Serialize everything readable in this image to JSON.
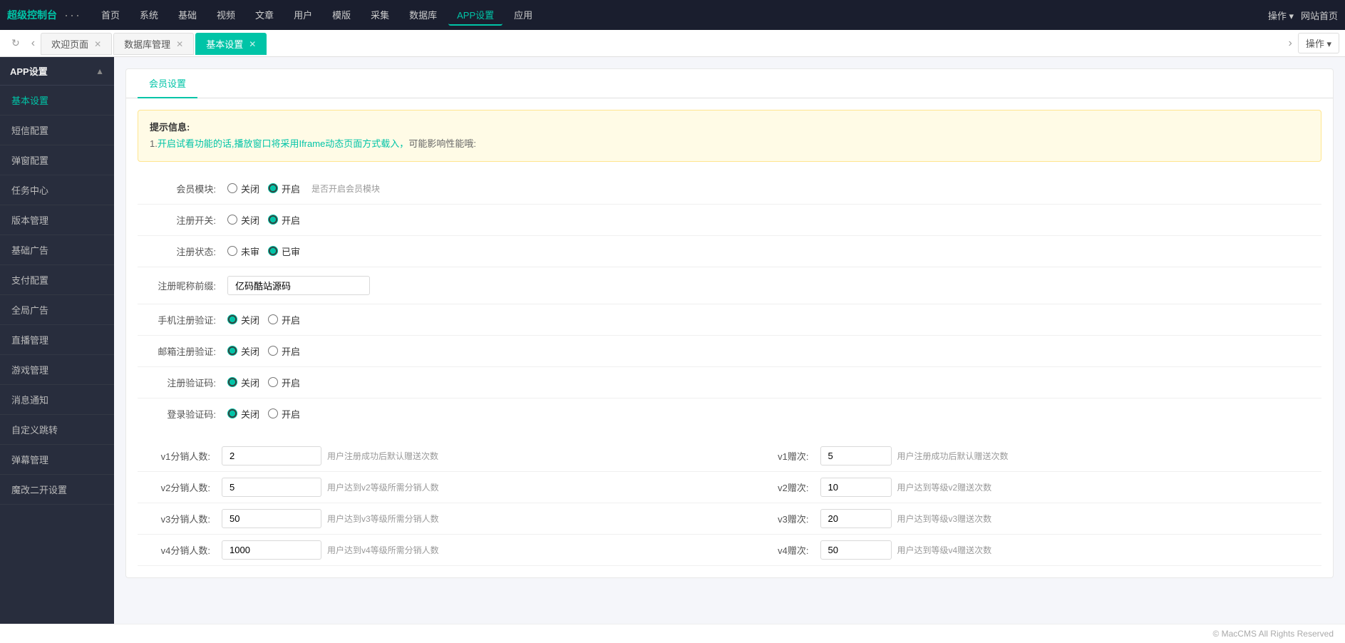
{
  "brand": "超级控制台",
  "nav": {
    "dots": "···",
    "items": [
      {
        "label": "首页",
        "active": false
      },
      {
        "label": "系统",
        "active": false
      },
      {
        "label": "基础",
        "active": false
      },
      {
        "label": "视频",
        "active": false
      },
      {
        "label": "文章",
        "active": false
      },
      {
        "label": "用户",
        "active": false
      },
      {
        "label": "模版",
        "active": false
      },
      {
        "label": "采集",
        "active": false
      },
      {
        "label": "数据库",
        "active": false
      },
      {
        "label": "APP设置",
        "active": true
      },
      {
        "label": "应用",
        "active": false
      }
    ],
    "right": {
      "action_label": "操作",
      "site_label": "网站首页"
    }
  },
  "tabs": {
    "refresh_icon": "↻",
    "prev_icon": "‹",
    "next_icon": "›",
    "items": [
      {
        "label": "欢迎页面",
        "active": false
      },
      {
        "label": "数据库管理",
        "active": false
      },
      {
        "label": "基本设置",
        "active": true
      }
    ],
    "action_label": "操作"
  },
  "sidebar": {
    "title": "APP设置",
    "collapse_icon": "▲",
    "items": [
      {
        "label": "基本设置",
        "active": true
      },
      {
        "label": "短信配置",
        "active": false
      },
      {
        "label": "弹窗配置",
        "active": false
      },
      {
        "label": "任务中心",
        "active": false
      },
      {
        "label": "版本管理",
        "active": false
      },
      {
        "label": "基础广告",
        "active": false
      },
      {
        "label": "支付配置",
        "active": false
      },
      {
        "label": "全局广告",
        "active": false
      },
      {
        "label": "直播管理",
        "active": false
      },
      {
        "label": "游戏管理",
        "active": false
      },
      {
        "label": "消息通知",
        "active": false
      },
      {
        "label": "自定义跳转",
        "active": false
      },
      {
        "label": "弹幕管理",
        "active": false
      },
      {
        "label": "魔改二开设置",
        "active": false
      }
    ]
  },
  "main": {
    "card_tab": "会员设置",
    "tip": {
      "title": "提示信息:",
      "lines": [
        "1.开启试看功能的话,播放窗口将采用Iframe动态页面方式载入，可能影响性能哦:"
      ]
    },
    "form": {
      "member_module": {
        "label": "会员模块:",
        "options": [
          {
            "label": "关闭",
            "value": "off"
          },
          {
            "label": "开启",
            "value": "on",
            "checked": true
          }
        ],
        "hint": "是否开启会员模块"
      },
      "register_open": {
        "label": "注册开关:",
        "options": [
          {
            "label": "关闭",
            "value": "off"
          },
          {
            "label": "开启",
            "value": "on",
            "checked": true
          }
        ]
      },
      "register_status": {
        "label": "注册状态:",
        "options": [
          {
            "label": "未审",
            "value": "pending"
          },
          {
            "label": "已审",
            "value": "approved",
            "checked": true
          }
        ]
      },
      "register_nickname_prefix": {
        "label": "注册昵称前缀:",
        "value": "亿码酷站源码"
      },
      "mobile_verify": {
        "label": "手机注册验证:",
        "options": [
          {
            "label": "关闭",
            "value": "off",
            "checked": true
          },
          {
            "label": "开启",
            "value": "on"
          }
        ]
      },
      "email_verify": {
        "label": "邮箱注册验证:",
        "options": [
          {
            "label": "关闭",
            "value": "off",
            "checked": true
          },
          {
            "label": "开启",
            "value": "on"
          }
        ]
      },
      "register_captcha": {
        "label": "注册验证码:",
        "options": [
          {
            "label": "关闭",
            "value": "off",
            "checked": true
          },
          {
            "label": "开启",
            "value": "on"
          }
        ]
      },
      "login_captcha": {
        "label": "登录验证码:",
        "options": [
          {
            "label": "关闭",
            "value": "off",
            "checked": true
          },
          {
            "label": "开启",
            "value": "on"
          }
        ]
      }
    },
    "grid": {
      "rows": [
        {
          "left_label": "v1分销人数:",
          "left_value": "2",
          "left_hint": "用户注册成功后默认赠送次数",
          "right_label": "v1赠次:",
          "right_value": "5",
          "right_hint": "用户注册成功后默认赠送次数"
        },
        {
          "left_label": "v2分销人数:",
          "left_value": "5",
          "left_hint": "用户达到v2等级所需分销人数",
          "right_label": "v2赠次:",
          "right_value": "10",
          "right_hint": "用户达到等级v2赠送次数"
        },
        {
          "left_label": "v3分销人数:",
          "left_value": "50",
          "left_hint": "用户达到v3等级所需分销人数",
          "right_label": "v3赠次:",
          "right_value": "20",
          "right_hint": "用户达到等级v3赠送次数"
        },
        {
          "left_label": "v4分销人数:",
          "left_value": "1000",
          "left_hint": "用户达到v4等级所需分销人数",
          "right_label": "v4赠次:",
          "right_value": "50",
          "right_hint": "用户达到等级v4赠送次数"
        }
      ]
    }
  },
  "footer": {
    "text": "© MacCMS All Rights Reserved"
  }
}
